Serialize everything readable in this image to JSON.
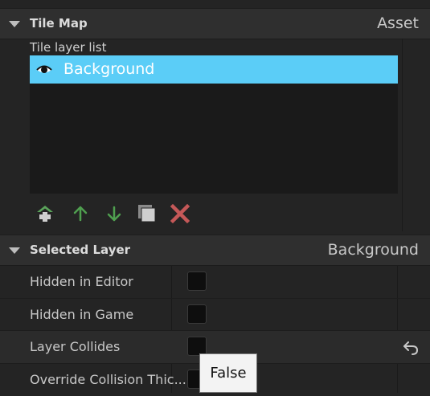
{
  "tile_map_section": {
    "title": "Tile Map",
    "category": "Asset",
    "layer_list_label": "Tile layer list",
    "layers": [
      {
        "name": "Background",
        "visible": true,
        "selected": true
      }
    ],
    "toolbar": {
      "add_icon": "add-layer-icon",
      "up_icon": "arrow-up-icon",
      "down_icon": "arrow-down-icon",
      "duplicate_icon": "duplicate-icon",
      "delete_icon": "delete-icon"
    }
  },
  "selected_layer_section": {
    "title": "Selected Layer",
    "layer_name": "Background",
    "properties": [
      {
        "label": "Hidden in Editor",
        "value": false
      },
      {
        "label": "Hidden in Game",
        "value": false
      },
      {
        "label": "Layer Collides",
        "value": false,
        "highlighted": true
      },
      {
        "label": "Override Collision Thic...",
        "value": false
      }
    ]
  },
  "tooltip": {
    "text": "False"
  },
  "colors": {
    "selection": "#5bcdf7",
    "panel": "#242424",
    "header": "#2f2f2f",
    "list_bg": "#1a1a1a",
    "add_green": "#5aa35a",
    "delete_red": "#c45858"
  }
}
